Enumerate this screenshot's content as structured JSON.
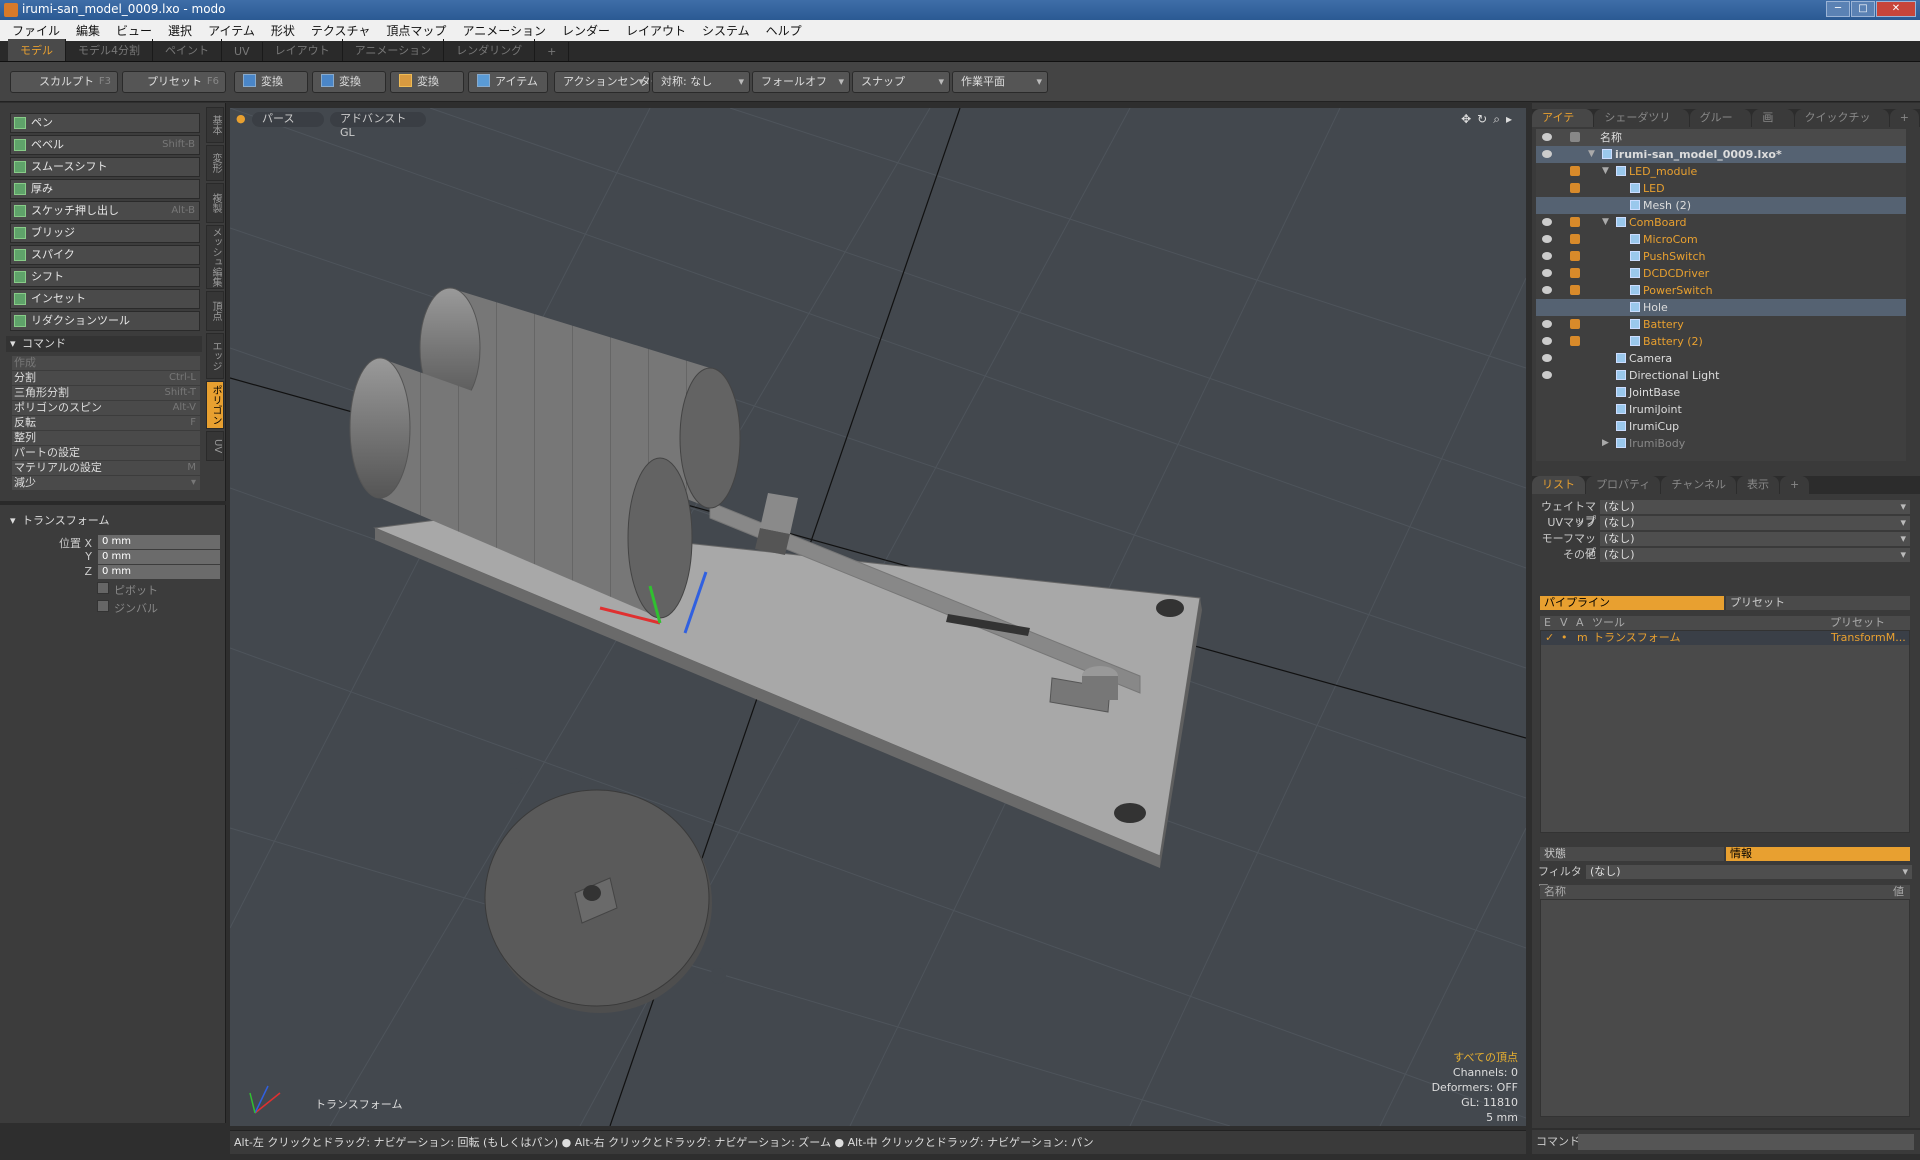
{
  "window": {
    "title": "irumi-san_model_0009.lxo - modo",
    "buttons": [
      "─",
      "□",
      "✕"
    ]
  },
  "menu": [
    "ファイル",
    "編集",
    "ビュー",
    "選択",
    "アイテム",
    "形状",
    "テクスチャ",
    "頂点マップ",
    "アニメーション",
    "レンダー",
    "レイアウト",
    "システム",
    "ヘルプ"
  ],
  "layout_tabs": [
    "モデル",
    "モデル4分割",
    "ペイント",
    "UV",
    "レイアウト",
    "アニメーション",
    "レンダリング",
    "+"
  ],
  "toolbar": {
    "sculpt": "スカルプト",
    "sculpt_key": "F3",
    "preset": "プリセット",
    "preset_key": "F6",
    "transform1": "変換",
    "transform2": "変換",
    "transform3": "変換",
    "item": "アイテム",
    "action_center": "アクションセンター",
    "symmetry": "対称: なし",
    "falloff": "フォールオフ",
    "snap": "スナップ",
    "workplane": "作業平面"
  },
  "tools": [
    {
      "label": "ペン",
      "key": ""
    },
    {
      "label": "ベベル",
      "key": "Shift-B"
    },
    {
      "label": "スムースシフト",
      "key": ""
    },
    {
      "label": "厚み",
      "key": ""
    },
    {
      "label": "スケッチ押し出し",
      "key": "Alt-B"
    },
    {
      "label": "ブリッジ",
      "key": ""
    },
    {
      "label": "スパイク",
      "key": ""
    },
    {
      "label": "シフト",
      "key": ""
    },
    {
      "label": "インセット",
      "key": ""
    },
    {
      "label": "リダクションツール",
      "key": ""
    }
  ],
  "vertical_tabs": [
    "基本",
    "変形",
    "複製",
    "メッシュ編集",
    "頂点",
    "エッジ",
    "ポリゴン",
    "UV"
  ],
  "commands": {
    "header": "コマンド",
    "items": [
      {
        "label": "作成",
        "key": "",
        "dim": true
      },
      {
        "label": "分割",
        "key": "Ctrl-L",
        "dim": false
      },
      {
        "label": "三角形分割",
        "key": "Shift-T",
        "dim": false
      },
      {
        "label": "ポリゴンのスピン",
        "key": "Alt-V",
        "dim": false
      },
      {
        "label": "反転",
        "key": "F",
        "dim": false
      },
      {
        "label": "整列",
        "key": "",
        "dim": false
      },
      {
        "label": "パートの設定",
        "key": "",
        "dim": false
      },
      {
        "label": "マテリアルの設定",
        "key": "M",
        "dim": false
      },
      {
        "label": "減少",
        "key": "",
        "dim": false
      }
    ]
  },
  "transform": {
    "header": "トランスフォーム",
    "pos_label": "位置 X",
    "y_label": "Y",
    "z_label": "Z",
    "x": "0 mm",
    "y": "0 mm",
    "z": "0 mm",
    "pivot": "ピボット",
    "gimbal": "ジンバル"
  },
  "viewport": {
    "tab_perspective": "パース",
    "tab_render": "アドバンスト GL",
    "tool_label": "トランスフォーム",
    "info": {
      "all_vertices": "すべての頂点",
      "channels": "Channels: 0",
      "deformers": "Deformers: OFF",
      "gl": "GL: 11810",
      "scale": "5 mm"
    }
  },
  "status": "Alt-左 クリックとドラッグ: ナビゲーション: 回転 (もしくはパン) ● Alt-右 クリックとドラッグ: ナビゲーション: ズーム ● Alt-中 クリックとドラッグ: ナビゲーション: パン",
  "command_label": "コマンド",
  "items_panel": {
    "tabs": [
      "アイテム",
      "シェーダツリー",
      "グループ",
      "画像",
      "クイックチップ",
      "+"
    ],
    "name_header": "名称",
    "rows": [
      {
        "name": "irumi-san_model_0009.lxo*",
        "indent": 0,
        "arrow": "▼",
        "eye": true,
        "lock": false,
        "orange": false,
        "bold": true,
        "sel": true
      },
      {
        "name": "LED_module",
        "indent": 1,
        "arrow": "▼",
        "eye": false,
        "lock": true,
        "orange": true,
        "sel": false
      },
      {
        "name": "LED",
        "indent": 2,
        "arrow": "",
        "eye": false,
        "lock": true,
        "orange": true,
        "sel": false
      },
      {
        "name": "Mesh (2)",
        "indent": 2,
        "arrow": "",
        "eye": false,
        "lock": false,
        "orange": false,
        "sel": true
      },
      {
        "name": "ComBoard",
        "indent": 1,
        "arrow": "▼",
        "eye": true,
        "lock": true,
        "orange": true,
        "sel": false
      },
      {
        "name": "MicroCom",
        "indent": 2,
        "arrow": "",
        "eye": true,
        "lock": true,
        "orange": true,
        "sel": false
      },
      {
        "name": "PushSwitch",
        "indent": 2,
        "arrow": "",
        "eye": true,
        "lock": true,
        "orange": true,
        "sel": false
      },
      {
        "name": "DCDCDriver",
        "indent": 2,
        "arrow": "",
        "eye": true,
        "lock": true,
        "orange": true,
        "sel": false
      },
      {
        "name": "PowerSwitch",
        "indent": 2,
        "arrow": "",
        "eye": true,
        "lock": true,
        "orange": true,
        "sel": false
      },
      {
        "name": "Hole",
        "indent": 2,
        "arrow": "",
        "eye": false,
        "lock": false,
        "orange": false,
        "sel": true
      },
      {
        "name": "Battery",
        "indent": 2,
        "arrow": "",
        "eye": true,
        "lock": true,
        "orange": true,
        "sel": false
      },
      {
        "name": "Battery (2)",
        "indent": 2,
        "arrow": "",
        "eye": true,
        "lock": true,
        "orange": true,
        "sel": false
      },
      {
        "name": "Camera",
        "indent": 1,
        "arrow": "",
        "eye": true,
        "lock": false,
        "orange": false,
        "sel": false
      },
      {
        "name": "Directional Light",
        "indent": 1,
        "arrow": "",
        "eye": true,
        "lock": false,
        "orange": false,
        "sel": false
      },
      {
        "name": "JointBase",
        "indent": 1,
        "arrow": "",
        "eye": false,
        "lock": false,
        "orange": false,
        "sel": false
      },
      {
        "name": "IrumiJoint",
        "indent": 1,
        "arrow": "",
        "eye": false,
        "lock": false,
        "orange": false,
        "sel": false
      },
      {
        "name": "IrumiCup",
        "indent": 1,
        "arrow": "",
        "eye": false,
        "lock": false,
        "orange": false,
        "sel": false
      },
      {
        "name": "IrumiBody",
        "indent": 1,
        "arrow": "▶",
        "eye": false,
        "lock": false,
        "orange": false,
        "dim": true,
        "sel": false
      }
    ]
  },
  "list_panel": {
    "tabs": [
      "リスト",
      "プロパティ",
      "チャンネル",
      "表示",
      "+"
    ],
    "rows": [
      {
        "label": "ウェイトマップ",
        "value": "(なし)"
      },
      {
        "label": "UVマップ",
        "value": "(なし)"
      },
      {
        "label": "モーフマップ",
        "value": "(なし)"
      },
      {
        "label": "その他",
        "value": "(なし)"
      }
    ]
  },
  "pipeline": {
    "tab_pipeline": "パイプライン",
    "tab_preset": "プリセット",
    "headers": [
      "E",
      "V",
      "A",
      "ツール",
      "プリセット"
    ],
    "row": {
      "e": "✓",
      "v": "•",
      "a": "m",
      "tool": "トランスフォーム",
      "preset": "TransformM..."
    }
  },
  "info_panel": {
    "tab_state": "状態",
    "tab_info": "情報",
    "filter_label": "フィルター",
    "filter_value": "(なし)",
    "col_name": "名称",
    "col_value": "値"
  },
  "colors": {
    "accent": "#e8a030",
    "selection": "#556272",
    "viewport_bg": "#43484e"
  }
}
